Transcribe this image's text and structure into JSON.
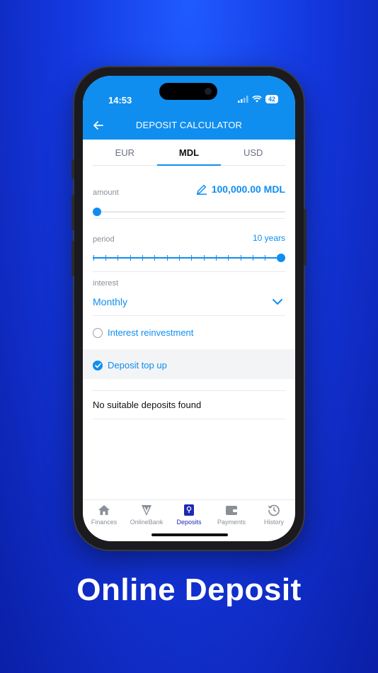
{
  "status_bar": {
    "time": "14:53",
    "battery": "42"
  },
  "header": {
    "title": "DEPOSIT CALCULATOR"
  },
  "currency_tabs": [
    {
      "label": "EUR",
      "active": false
    },
    {
      "label": "MDL",
      "active": true
    },
    {
      "label": "USD",
      "active": false
    }
  ],
  "amount": {
    "label": "amount",
    "value": "100,000.00 MDL",
    "slider_fraction": 0.0
  },
  "period": {
    "label": "period",
    "value": "10 years",
    "slider_fraction": 1.0
  },
  "interest": {
    "label": "interest",
    "value": "Monthly"
  },
  "options": {
    "reinvestment": {
      "label": "Interest reinvestment",
      "checked": false
    },
    "top_up": {
      "label": "Deposit top up",
      "checked": true
    }
  },
  "results": {
    "message": "No suitable deposits found"
  },
  "bottom_nav": [
    {
      "label": "Finances",
      "icon": "home-icon",
      "active": false
    },
    {
      "label": "OnlineBank",
      "icon": "onlinebank-icon",
      "active": false
    },
    {
      "label": "Deposits",
      "icon": "deposits-icon",
      "active": true
    },
    {
      "label": "Payments",
      "icon": "wallet-icon",
      "active": false
    },
    {
      "label": "History",
      "icon": "history-icon",
      "active": false
    }
  ],
  "caption": "Online Deposit",
  "colors": {
    "accent": "#0f8ef0",
    "nav_active": "#1d2bb3",
    "background": "#1438e0"
  }
}
